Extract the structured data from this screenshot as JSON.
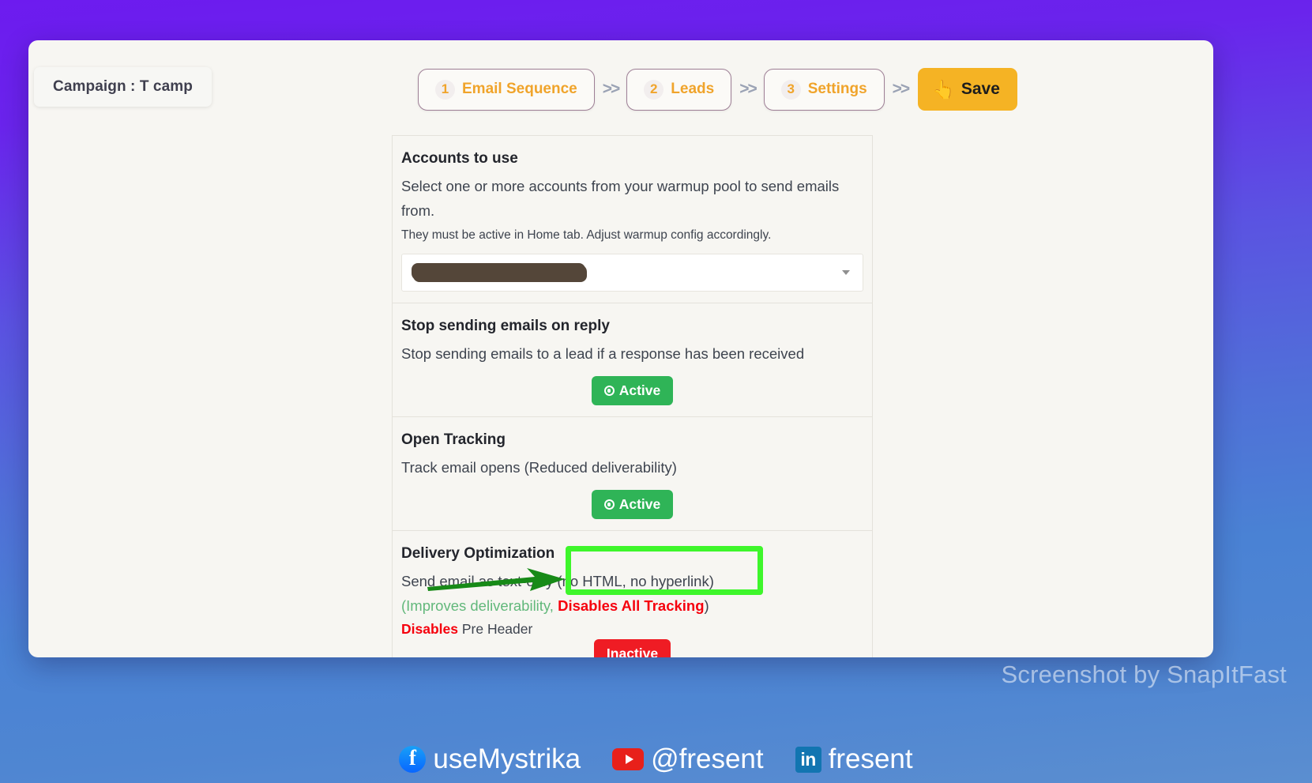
{
  "header": {
    "campaign_label": "Campaign : T camp",
    "steps": [
      {
        "num": "1",
        "label": "Email Sequence"
      },
      {
        "num": "2",
        "label": "Leads"
      },
      {
        "num": "3",
        "label": "Settings"
      }
    ],
    "separator": ">>",
    "save_label": "Save",
    "save_icon": "clicking-hand-emoji"
  },
  "settings": {
    "accounts": {
      "title": "Accounts to use",
      "description": "Select one or more accounts from your warmup pool to send emails from.",
      "note": "They must be active in Home tab. Adjust warmup config accordingly.",
      "selected_value": "",
      "selected_value_state": "redacted",
      "caret_icon": "chevron-down-icon"
    },
    "stop_on_reply": {
      "title": "Stop sending emails on reply",
      "description": "Stop sending emails to a lead if a response has been received",
      "toggle_label": "Active",
      "toggle_state": "active"
    },
    "open_tracking": {
      "title": "Open Tracking",
      "description": "Track email opens (Reduced deliverability)",
      "toggle_label": "Active",
      "toggle_state": "active"
    },
    "delivery_optimization": {
      "title": "Delivery Optimization",
      "description": "Send email as text-only (no HTML, no hyperlink)",
      "paren_open": "(",
      "improves_text": "Improves deliverability,",
      "disables_tracking_text": "Disables All Tracking",
      "paren_close": ")",
      "disables_word": "Disables",
      "preheader_word": " Pre Header",
      "toggle_label": "Inactive",
      "toggle_state": "inactive"
    }
  },
  "annotations": {
    "highlight_box_color": "#3ef62b",
    "arrow_color": "#178a17",
    "arrow_icon": "right-arrow-annotation",
    "box_icon": "highlight-rectangle-annotation"
  },
  "watermark": {
    "text": "Screenshot by SnapItFast"
  },
  "social": [
    {
      "icon": "facebook-icon",
      "glyph": "f",
      "label": "useMystrika"
    },
    {
      "icon": "youtube-icon",
      "glyph": "",
      "label": "@fresent"
    },
    {
      "icon": "linkedin-icon",
      "glyph": "in",
      "label": "fresent"
    }
  ],
  "colors": {
    "accent_orange": "#f5b324",
    "active_green": "#2fb457",
    "inactive_red": "#ef1c24",
    "annotation_green": "#3ef62b"
  }
}
